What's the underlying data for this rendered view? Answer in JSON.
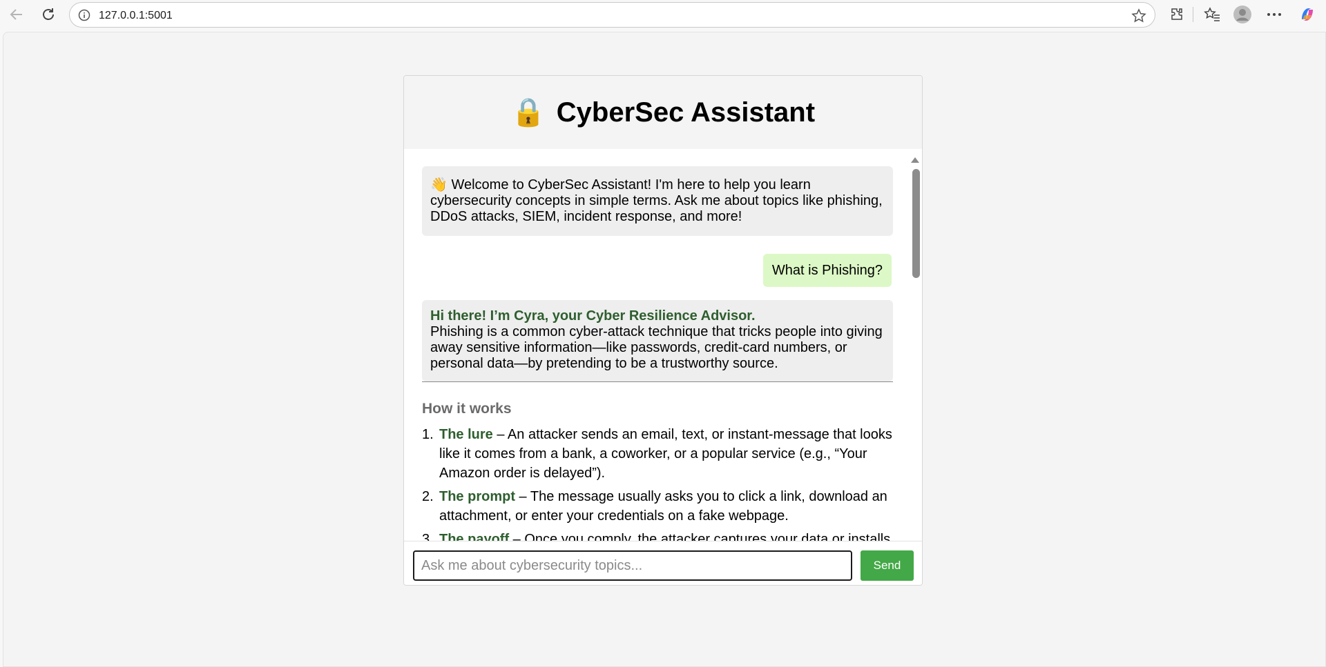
{
  "browser": {
    "url": "127.0.0.1:5001"
  },
  "header": {
    "lock_emoji": "🔒",
    "title": "CyberSec Assistant"
  },
  "messages": {
    "welcome_emoji": "👋",
    "welcome_text": "Welcome to CyberSec Assistant! I'm here to help you learn cybersecurity concepts in simple terms. Ask me about topics like phishing, DDoS attacks, SIEM, incident response, and more!",
    "user_question": "What is Phishing?",
    "bot_greeting": "Hi there! I’m Cyra, your Cyber Resilience Advisor.",
    "bot_answer": "Phishing is a common cyber-attack technique that tricks people into giving away sensitive information—like passwords, credit-card numbers, or personal data—by pretending to be a trustworthy source.",
    "section_title": "How it works",
    "steps": [
      {
        "num": "1.",
        "key": "The lure",
        "text": " – An attacker sends an email, text, or instant-message that looks like it comes from a bank, a coworker, or a popular service (e.g., “Your Amazon order is delayed”)."
      },
      {
        "num": "2.",
        "key": "The prompt",
        "text": " – The message usually asks you to click a link, download an attachment, or enter your credentials on a fake webpage."
      },
      {
        "num": "3.",
        "key": "The payoff",
        "text": " – Once you comply, the attacker captures your data or installs malware."
      }
    ]
  },
  "input": {
    "placeholder": "Ask me about cybersecurity topics...",
    "send_label": "Send"
  },
  "colors": {
    "accent_green": "#43a847",
    "bot_heading_green": "#2e5e2e",
    "user_bubble": "#dcf8c6",
    "bot_bubble": "#eeeeee"
  }
}
